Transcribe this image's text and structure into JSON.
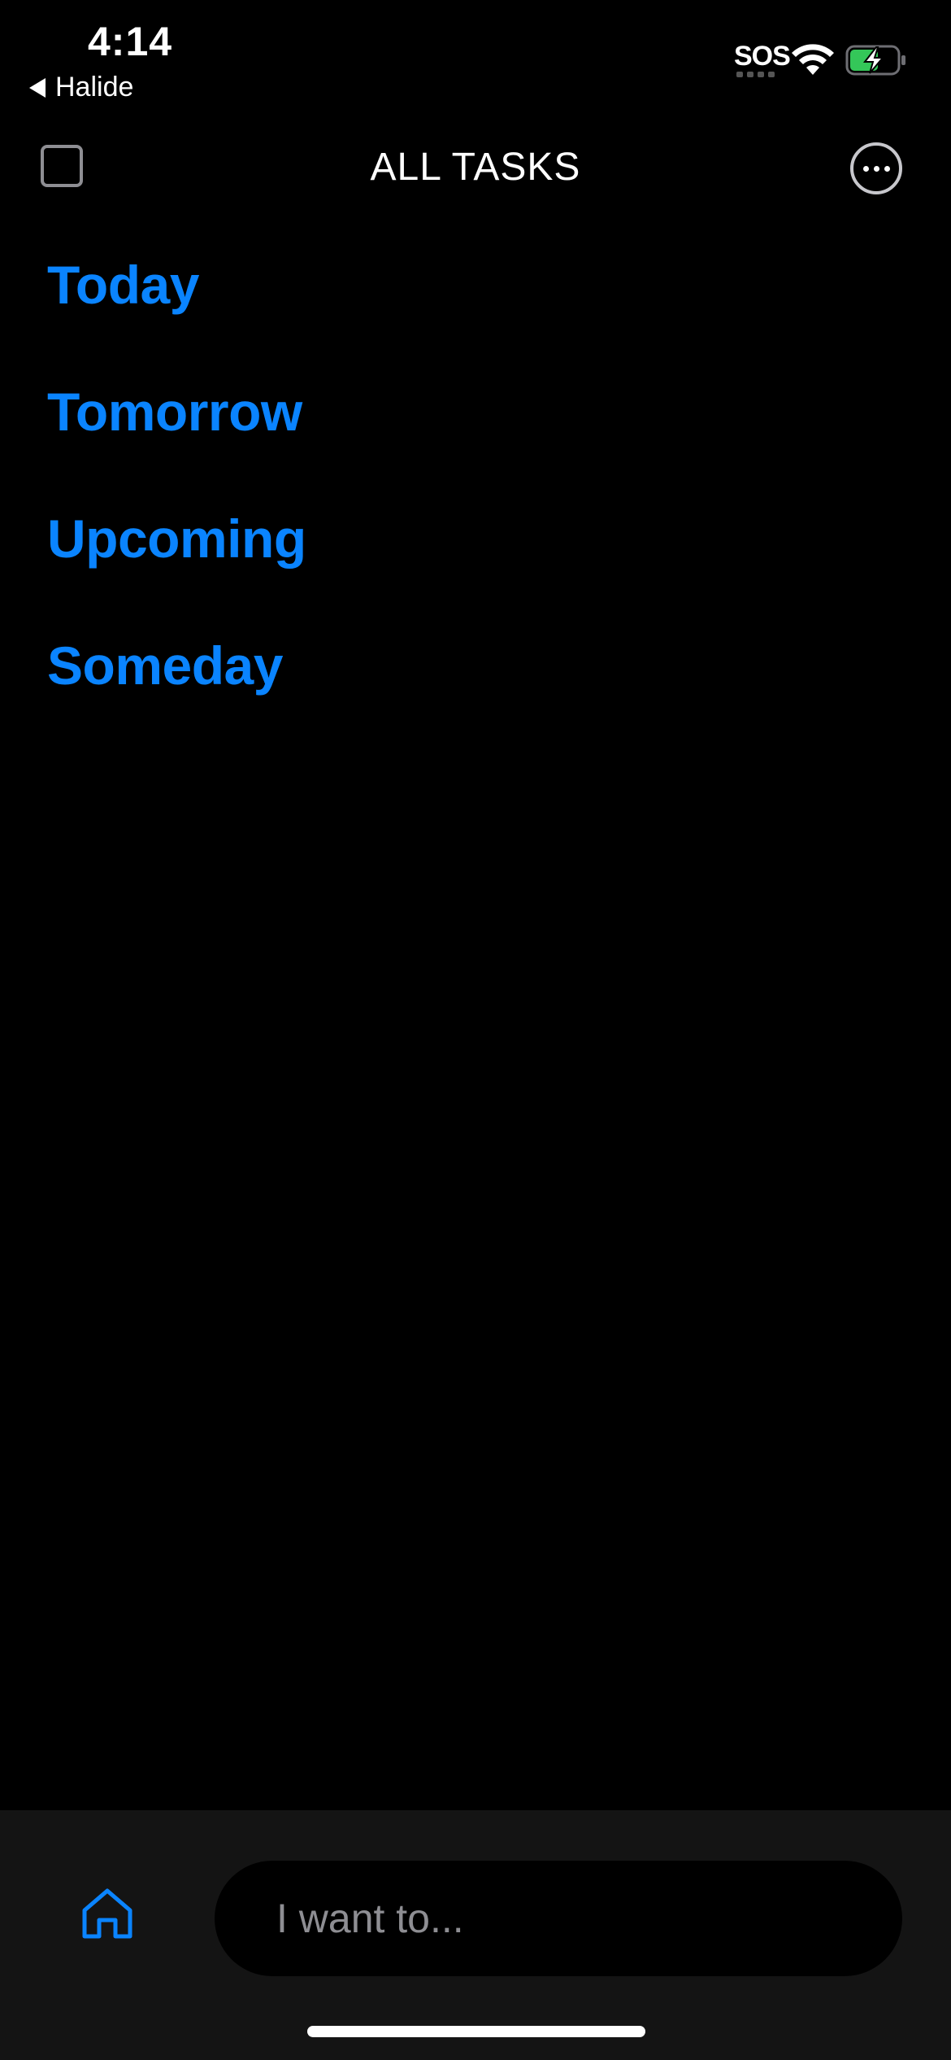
{
  "status_bar": {
    "time": "4:14",
    "back_app": "Halide",
    "carrier": "SOS",
    "icons": [
      "wifi-icon",
      "battery-charging-icon"
    ],
    "battery_color": "#34c759"
  },
  "header": {
    "title": "ALL TASKS",
    "left_icon": "checkbox-icon",
    "right_icon": "more-options-icon"
  },
  "task_groups": [
    {
      "label": "Today"
    },
    {
      "label": "Tomorrow"
    },
    {
      "label": "Upcoming"
    },
    {
      "label": "Someday"
    }
  ],
  "bottom_bar": {
    "home_icon": "home-icon",
    "input_placeholder": "I want to...",
    "input_value": ""
  },
  "colors": {
    "accent": "#0a84ff",
    "background": "#000000",
    "bar_background": "#141414"
  }
}
